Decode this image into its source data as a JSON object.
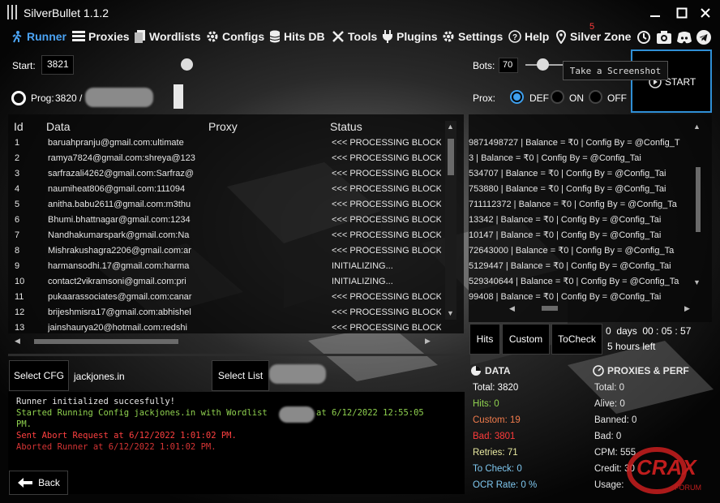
{
  "app": {
    "title": "SilverBullet 1.1.2"
  },
  "nav": [
    {
      "label": "Runner",
      "icon": "runner-icon"
    },
    {
      "label": "Proxies",
      "icon": "proxies-icon"
    },
    {
      "label": "Wordlists",
      "icon": "wordlists-icon"
    },
    {
      "label": "Configs",
      "icon": "configs-gear-icon"
    },
    {
      "label": "Hits DB",
      "icon": "database-icon"
    },
    {
      "label": "Tools",
      "icon": "tools-icon"
    },
    {
      "label": "Plugins",
      "icon": "plug-icon"
    },
    {
      "label": "Settings",
      "icon": "settings-gear-icon"
    },
    {
      "label": "Help",
      "icon": "help-icon"
    },
    {
      "label": "Silver Zone",
      "icon": "location-pin-icon",
      "badge": "5"
    }
  ],
  "toolbar": {
    "tooltip": "Take a Screenshot"
  },
  "runner": {
    "start_label": "Start:",
    "start_value": "3821",
    "prog_label": "Prog:",
    "prog_value": "3820 /",
    "bots_label": "Bots:",
    "bots_value": "70",
    "prox_label": "Prox:",
    "prox_options": [
      "DEF",
      "ON",
      "OFF"
    ],
    "prox_selected": "DEF",
    "start_button": "START"
  },
  "grid": {
    "headers": [
      "Id",
      "Data",
      "Proxy",
      "Status"
    ],
    "rows": [
      {
        "id": "1",
        "data": "baruahpranju@gmail.com:ultimate",
        "status": "<<< PROCESSING BLOCK"
      },
      {
        "id": "2",
        "data": "ramya7824@gmail.com:shreya@123",
        "status": "<<< PROCESSING BLOCK"
      },
      {
        "id": "3",
        "data": "sarfrazali4262@gmail.com:Sarfraz@",
        "status": "<<< PROCESSING BLOCK"
      },
      {
        "id": "4",
        "data": "naumiheat806@gmail.com:111094",
        "status": "<<< PROCESSING BLOCK"
      },
      {
        "id": "5",
        "data": "anitha.babu2611@gmail.com:m3thu",
        "status": "<<< PROCESSING BLOCK"
      },
      {
        "id": "6",
        "data": "Bhumi.bhattnagar@gmail.com:1234",
        "status": "<<< PROCESSING BLOCK"
      },
      {
        "id": "7",
        "data": "Nandhakumarspark@gmail.com:Na",
        "status": "<<< PROCESSING BLOCK"
      },
      {
        "id": "8",
        "data": "Mishrakushagra2206@gmail.com:ar",
        "status": "<<< PROCESSING BLOCK"
      },
      {
        "id": "9",
        "data": "harmansodhi.17@gmail.com:harma",
        "status": "INITIALIZING..."
      },
      {
        "id": "10",
        "data": "contact2vikramsoni@gmail.com:pri",
        "status": "INITIALIZING..."
      },
      {
        "id": "11",
        "data": "pukaarassociates@gmail.com:canar",
        "status": "<<< PROCESSING BLOCK"
      },
      {
        "id": "12",
        "data": "brijeshmisra17@gmail.com:abhishel",
        "status": "<<< PROCESSING BLOCK"
      },
      {
        "id": "13",
        "data": "jainshaurya20@hotmail.com:redshi",
        "status": "<<< PROCESSING BLOCK"
      }
    ]
  },
  "hits_grid": {
    "rows": [
      "9871498727 | Balance = ₹0 | Config By = @Config_T",
      "3 | Balance = ₹0 | Config By = @Config_Tai",
      "534707 | Balance = ₹0 | Config By = @Config_Tai",
      "753880 | Balance = ₹0 | Config By = @Config_Tai",
      "711112372 | Balance = ₹0 | Config By = @Config_Ta",
      "13342 | Balance = ₹0 | Config By = @Config_Tai",
      "10147 | Balance = ₹0 | Config By = @Config_Tai",
      "72643000 | Balance = ₹0 | Config By = @Config_Ta",
      "5129447 | Balance = ₹0 | Config By = @Config_Tai",
      "529340644 | Balance = ₹0 | Config By = @Config_Ta",
      "99408 | Balance = ₹0 | Config By = @Config_Tai"
    ],
    "tabs": [
      "Hits",
      "Custom",
      "ToCheck"
    ],
    "timer": "0  days  00 : 05 : 57",
    "remaining": "5 hours left"
  },
  "bottom": {
    "select_cfg": "Select CFG",
    "cfg_name": "jackjones.in",
    "select_list": "Select List",
    "back": "Back"
  },
  "log": [
    {
      "text": "Runner initialized succesfully!",
      "color": "#ffffff"
    },
    {
      "text": "Started Running Config jackjones.in with Wordlist",
      "color": "#8fd14f"
    },
    {
      "text": "at 6/12/2022 12:55:05",
      "color": "#8fd14f"
    },
    {
      "text": "PM.",
      "color": "#8fd14f"
    },
    {
      "text": "Sent Abort Request at 6/12/2022 1:01:02 PM.",
      "color": "#ff4040"
    },
    {
      "text": "Aborted Runner at 6/12/2022 1:01:02 PM.",
      "color": "#d43434"
    }
  ],
  "stats": {
    "data_title": "DATA",
    "total": "Total:  3820",
    "hits": "Hits:  0",
    "custom": "Custom:  19",
    "bad": "Bad:  3801",
    "retries": "Retries:  71",
    "to_check": "To Check:  0",
    "ocr": "OCR Rate:  0 %",
    "proxies_title": "PROXIES & PERF",
    "p_total": "Total:  0",
    "p_alive": "Alive:  0",
    "p_banned": "Banned:  0",
    "p_bad": "Bad:  0",
    "cpm": "CPM:  555",
    "credit": "Credit:  30",
    "usage": "Usage:"
  },
  "watermark": {
    "text": "CRAX",
    "sub": "FORUM"
  },
  "colors": {
    "accent": "#4ba3f3",
    "hits": "#8fd14f",
    "custom": "#f07b4c",
    "bad": "#ff3b3b"
  }
}
